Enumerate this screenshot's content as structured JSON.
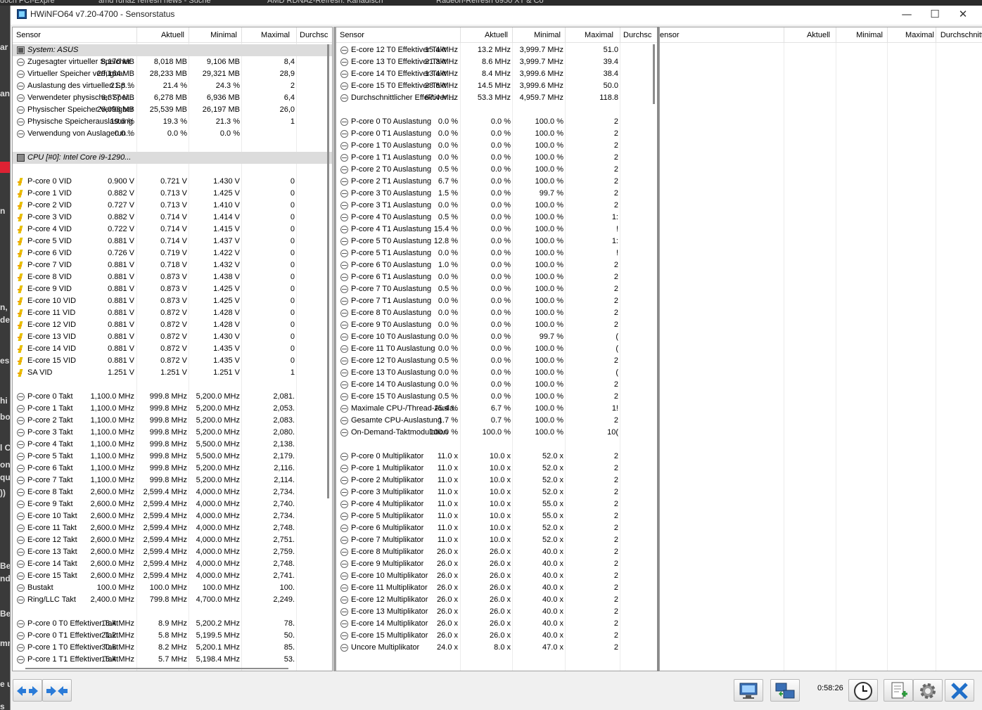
{
  "window": {
    "title": "HWiNFO64 v7.20-4700 - Sensorstatus",
    "minimize": "—",
    "maximize": "☐",
    "close": "✕"
  },
  "background_tabs": [
    "doch PCI-Expre",
    "amd rdna2 refresh news - Suche",
    "AMD RDNA2-Refresh: Kanadisch",
    "Radeon-Refresh 6950 XT & Co"
  ],
  "background_left_text": [
    "ar",
    "an",
    "n",
    "n,",
    "de",
    "es",
    "hi",
    "bo",
    "l C",
    "on",
    "qu",
    "))",
    "Be",
    "nd",
    "Be",
    "mr",
    "e u",
    "s"
  ],
  "columns": {
    "sensor": "Sensor",
    "current": "Aktuell",
    "min": "Minimal",
    "max": "Maximal",
    "avg": "Durchschnitt"
  },
  "panel1": [
    {
      "t": "sec",
      "icon": "comp",
      "name": "System: ASUS"
    },
    {
      "icon": "clock",
      "name": "Zugesagter virtueller Speicher",
      "cur": "8,176 MB",
      "min": "8,018 MB",
      "max": "9,106 MB",
      "avg": "8,4"
    },
    {
      "icon": "clock",
      "name": "Virtueller Speicher verfügbar",
      "cur": "29,164 MB",
      "min": "28,233 MB",
      "max": "29,321 MB",
      "avg": "28,9"
    },
    {
      "icon": "clock",
      "name": "Auslastung des virtuellen Sp...",
      "cur": "21.8 %",
      "min": "21.4 %",
      "max": "24.3 %",
      "avg": "2"
    },
    {
      "icon": "clock",
      "name": "Verwendeter physischer Spei...",
      "cur": "6,377 MB",
      "min": "6,278 MB",
      "max": "6,936 MB",
      "avg": "6,4"
    },
    {
      "icon": "clock",
      "name": "Physischer Speicher Verfügbar",
      "cur": "26,098 MB",
      "min": "25,539 MB",
      "max": "26,197 MB",
      "avg": "26,0"
    },
    {
      "icon": "clock",
      "name": "Physische Speicherauslastung",
      "cur": "19.6 %",
      "min": "19.3 %",
      "max": "21.3 %",
      "avg": "1"
    },
    {
      "icon": "clock",
      "name": "Verwendung von Auslagerun...",
      "cur": "0.0 %",
      "min": "0.0 %",
      "max": "0.0 %",
      "avg": ""
    },
    {
      "t": "blank"
    },
    {
      "t": "sec",
      "icon": "cpu",
      "name": "CPU [#0]: Intel Core i9-1290..."
    },
    {
      "t": "blank"
    },
    {
      "icon": "volt",
      "name": "P-core 0 VID",
      "cur": "0.900 V",
      "min": "0.721 V",
      "max": "1.430 V",
      "avg": "0"
    },
    {
      "icon": "volt",
      "name": "P-core 1 VID",
      "cur": "0.882 V",
      "min": "0.713 V",
      "max": "1.425 V",
      "avg": "0"
    },
    {
      "icon": "volt",
      "name": "P-core 2 VID",
      "cur": "0.727 V",
      "min": "0.713 V",
      "max": "1.410 V",
      "avg": "0"
    },
    {
      "icon": "volt",
      "name": "P-core 3 VID",
      "cur": "0.882 V",
      "min": "0.714 V",
      "max": "1.414 V",
      "avg": "0"
    },
    {
      "icon": "volt",
      "name": "P-core 4 VID",
      "cur": "0.722 V",
      "min": "0.714 V",
      "max": "1.415 V",
      "avg": "0"
    },
    {
      "icon": "volt",
      "name": "P-core 5 VID",
      "cur": "0.881 V",
      "min": "0.714 V",
      "max": "1.437 V",
      "avg": "0"
    },
    {
      "icon": "volt",
      "name": "P-core 6 VID",
      "cur": "0.726 V",
      "min": "0.719 V",
      "max": "1.422 V",
      "avg": "0"
    },
    {
      "icon": "volt",
      "name": "P-core 7 VID",
      "cur": "0.881 V",
      "min": "0.718 V",
      "max": "1.432 V",
      "avg": "0"
    },
    {
      "icon": "volt",
      "name": "E-core 8 VID",
      "cur": "0.881 V",
      "min": "0.873 V",
      "max": "1.438 V",
      "avg": "0"
    },
    {
      "icon": "volt",
      "name": "E-core 9 VID",
      "cur": "0.881 V",
      "min": "0.873 V",
      "max": "1.425 V",
      "avg": "0"
    },
    {
      "icon": "volt",
      "name": "E-core 10 VID",
      "cur": "0.881 V",
      "min": "0.873 V",
      "max": "1.425 V",
      "avg": "0"
    },
    {
      "icon": "volt",
      "name": "E-core 11 VID",
      "cur": "0.881 V",
      "min": "0.872 V",
      "max": "1.428 V",
      "avg": "0"
    },
    {
      "icon": "volt",
      "name": "E-core 12 VID",
      "cur": "0.881 V",
      "min": "0.872 V",
      "max": "1.428 V",
      "avg": "0"
    },
    {
      "icon": "volt",
      "name": "E-core 13 VID",
      "cur": "0.881 V",
      "min": "0.872 V",
      "max": "1.430 V",
      "avg": "0"
    },
    {
      "icon": "volt",
      "name": "E-core 14 VID",
      "cur": "0.881 V",
      "min": "0.872 V",
      "max": "1.435 V",
      "avg": "0"
    },
    {
      "icon": "volt",
      "name": "E-core 15 VID",
      "cur": "0.881 V",
      "min": "0.872 V",
      "max": "1.435 V",
      "avg": "0"
    },
    {
      "icon": "volt",
      "name": "SA VID",
      "cur": "1.251 V",
      "min": "1.251 V",
      "max": "1.251 V",
      "avg": "1"
    },
    {
      "t": "blank"
    },
    {
      "icon": "clock",
      "name": "P-core 0 Takt",
      "cur": "1,100.0 MHz",
      "min": "999.8 MHz",
      "max": "5,200.0 MHz",
      "avg": "2,081."
    },
    {
      "icon": "clock",
      "name": "P-core 1 Takt",
      "cur": "1,100.0 MHz",
      "min": "999.8 MHz",
      "max": "5,200.0 MHz",
      "avg": "2,053."
    },
    {
      "icon": "clock",
      "name": "P-core 2 Takt",
      "cur": "1,100.0 MHz",
      "min": "999.8 MHz",
      "max": "5,200.0 MHz",
      "avg": "2,083."
    },
    {
      "icon": "clock",
      "name": "P-core 3 Takt",
      "cur": "1,100.0 MHz",
      "min": "999.8 MHz",
      "max": "5,200.0 MHz",
      "avg": "2,080."
    },
    {
      "icon": "clock",
      "name": "P-core 4 Takt",
      "cur": "1,100.0 MHz",
      "min": "999.8 MHz",
      "max": "5,500.0 MHz",
      "avg": "2,138."
    },
    {
      "icon": "clock",
      "name": "P-core 5 Takt",
      "cur": "1,100.0 MHz",
      "min": "999.8 MHz",
      "max": "5,500.0 MHz",
      "avg": "2,179."
    },
    {
      "icon": "clock",
      "name": "P-core 6 Takt",
      "cur": "1,100.0 MHz",
      "min": "999.8 MHz",
      "max": "5,200.0 MHz",
      "avg": "2,116."
    },
    {
      "icon": "clock",
      "name": "P-core 7 Takt",
      "cur": "1,100.0 MHz",
      "min": "999.8 MHz",
      "max": "5,200.0 MHz",
      "avg": "2,114."
    },
    {
      "icon": "clock",
      "name": "E-core 8 Takt",
      "cur": "2,600.0 MHz",
      "min": "2,599.4 MHz",
      "max": "4,000.0 MHz",
      "avg": "2,734."
    },
    {
      "icon": "clock",
      "name": "E-core 9 Takt",
      "cur": "2,600.0 MHz",
      "min": "2,599.4 MHz",
      "max": "4,000.0 MHz",
      "avg": "2,740."
    },
    {
      "icon": "clock",
      "name": "E-core 10 Takt",
      "cur": "2,600.0 MHz",
      "min": "2,599.4 MHz",
      "max": "4,000.0 MHz",
      "avg": "2,734."
    },
    {
      "icon": "clock",
      "name": "E-core 11 Takt",
      "cur": "2,600.0 MHz",
      "min": "2,599.4 MHz",
      "max": "4,000.0 MHz",
      "avg": "2,748."
    },
    {
      "icon": "clock",
      "name": "E-core 12 Takt",
      "cur": "2,600.0 MHz",
      "min": "2,599.4 MHz",
      "max": "4,000.0 MHz",
      "avg": "2,751."
    },
    {
      "icon": "clock",
      "name": "E-core 13 Takt",
      "cur": "2,600.0 MHz",
      "min": "2,599.4 MHz",
      "max": "4,000.0 MHz",
      "avg": "2,759."
    },
    {
      "icon": "clock",
      "name": "E-core 14 Takt",
      "cur": "2,600.0 MHz",
      "min": "2,599.4 MHz",
      "max": "4,000.0 MHz",
      "avg": "2,748."
    },
    {
      "icon": "clock",
      "name": "E-core 15 Takt",
      "cur": "2,600.0 MHz",
      "min": "2,599.4 MHz",
      "max": "4,000.0 MHz",
      "avg": "2,741."
    },
    {
      "icon": "clock",
      "name": "Bustakt",
      "cur": "100.0 MHz",
      "min": "100.0 MHz",
      "max": "100.0 MHz",
      "avg": "100."
    },
    {
      "icon": "clock",
      "name": "Ring/LLC Takt",
      "cur": "2,400.0 MHz",
      "min": "799.8 MHz",
      "max": "4,700.0 MHz",
      "avg": "2,249."
    },
    {
      "t": "blank"
    },
    {
      "icon": "clock",
      "name": "P-core 0 T0 Effektiver Takt",
      "cur": "18.4 MHz",
      "min": "8.9 MHz",
      "max": "5,200.2 MHz",
      "avg": "78."
    },
    {
      "icon": "clock",
      "name": "P-core 0 T1 Effektiver Takt",
      "cur": "21.2 MHz",
      "min": "5.8 MHz",
      "max": "5,199.5 MHz",
      "avg": "50."
    },
    {
      "icon": "clock",
      "name": "P-core 1 T0 Effektiver Takt",
      "cur": "30.6 MHz",
      "min": "8.2 MHz",
      "max": "5,200.1 MHz",
      "avg": "85."
    },
    {
      "icon": "clock",
      "name": "P-core 1 T1 Effektiver Takt",
      "cur": "15.4 MHz",
      "min": "5.7 MHz",
      "max": "5,198.4 MHz",
      "avg": "53."
    }
  ],
  "panel2": [
    {
      "icon": "clock",
      "name": "E-core 12 T0 Effektiver Takt",
      "cur": "15.4 MHz",
      "min": "13.2 MHz",
      "max": "3,999.7 MHz",
      "avg": "51.0"
    },
    {
      "icon": "clock",
      "name": "E-core 13 T0 Effektiver Takt",
      "cur": "21.3 MHz",
      "min": "8.6 MHz",
      "max": "3,999.7 MHz",
      "avg": "39.4"
    },
    {
      "icon": "clock",
      "name": "E-core 14 T0 Effektiver Takt",
      "cur": "13.4 MHz",
      "min": "8.4 MHz",
      "max": "3,999.6 MHz",
      "avg": "38.4"
    },
    {
      "icon": "clock",
      "name": "E-core 15 T0 Effektiver Takt",
      "cur": "28.6 MHz",
      "min": "14.5 MHz",
      "max": "3,999.6 MHz",
      "avg": "50.0"
    },
    {
      "icon": "clock",
      "name": "Durchschnittlicher Effektiver ...",
      "cur": "67.4 MHz",
      "min": "53.3 MHz",
      "max": "4,959.7 MHz",
      "avg": "118.8"
    },
    {
      "t": "blank"
    },
    {
      "icon": "clock",
      "name": "P-core 0 T0 Auslastung",
      "cur": "0.0 %",
      "min": "0.0 %",
      "max": "100.0 %",
      "avg": "2"
    },
    {
      "icon": "clock",
      "name": "P-core 0 T1 Auslastung",
      "cur": "0.0 %",
      "min": "0.0 %",
      "max": "100.0 %",
      "avg": "2"
    },
    {
      "icon": "clock",
      "name": "P-core 1 T0 Auslastung",
      "cur": "0.0 %",
      "min": "0.0 %",
      "max": "100.0 %",
      "avg": "2"
    },
    {
      "icon": "clock",
      "name": "P-core 1 T1 Auslastung",
      "cur": "0.0 %",
      "min": "0.0 %",
      "max": "100.0 %",
      "avg": "2"
    },
    {
      "icon": "clock",
      "name": "P-core 2 T0 Auslastung",
      "cur": "0.5 %",
      "min": "0.0 %",
      "max": "100.0 %",
      "avg": "2"
    },
    {
      "icon": "clock",
      "name": "P-core 2 T1 Auslastung",
      "cur": "6.7 %",
      "min": "0.0 %",
      "max": "100.0 %",
      "avg": "2"
    },
    {
      "icon": "clock",
      "name": "P-core 3 T0 Auslastung",
      "cur": "1.5 %",
      "min": "0.0 %",
      "max": "99.7 %",
      "avg": "2"
    },
    {
      "icon": "clock",
      "name": "P-core 3 T1 Auslastung",
      "cur": "0.0 %",
      "min": "0.0 %",
      "max": "100.0 %",
      "avg": "2"
    },
    {
      "icon": "clock",
      "name": "P-core 4 T0 Auslastung",
      "cur": "0.5 %",
      "min": "0.0 %",
      "max": "100.0 %",
      "avg": "1:"
    },
    {
      "icon": "clock",
      "name": "P-core 4 T1 Auslastung",
      "cur": "15.4 %",
      "min": "0.0 %",
      "max": "100.0 %",
      "avg": "!"
    },
    {
      "icon": "clock",
      "name": "P-core 5 T0 Auslastung",
      "cur": "12.8 %",
      "min": "0.0 %",
      "max": "100.0 %",
      "avg": "1:"
    },
    {
      "icon": "clock",
      "name": "P-core 5 T1 Auslastung",
      "cur": "0.0 %",
      "min": "0.0 %",
      "max": "100.0 %",
      "avg": "!"
    },
    {
      "icon": "clock",
      "name": "P-core 6 T0 Auslastung",
      "cur": "1.0 %",
      "min": "0.0 %",
      "max": "100.0 %",
      "avg": "2"
    },
    {
      "icon": "clock",
      "name": "P-core 6 T1 Auslastung",
      "cur": "0.0 %",
      "min": "0.0 %",
      "max": "100.0 %",
      "avg": "2"
    },
    {
      "icon": "clock",
      "name": "P-core 7 T0 Auslastung",
      "cur": "0.5 %",
      "min": "0.0 %",
      "max": "100.0 %",
      "avg": "2"
    },
    {
      "icon": "clock",
      "name": "P-core 7 T1 Auslastung",
      "cur": "0.0 %",
      "min": "0.0 %",
      "max": "100.0 %",
      "avg": "2"
    },
    {
      "icon": "clock",
      "name": "E-core 8 T0 Auslastung",
      "cur": "0.0 %",
      "min": "0.0 %",
      "max": "100.0 %",
      "avg": "2"
    },
    {
      "icon": "clock",
      "name": "E-core 9 T0 Auslastung",
      "cur": "0.0 %",
      "min": "0.0 %",
      "max": "100.0 %",
      "avg": "2"
    },
    {
      "icon": "clock",
      "name": "E-core 10 T0 Auslastung",
      "cur": "0.0 %",
      "min": "0.0 %",
      "max": "99.7 %",
      "avg": "("
    },
    {
      "icon": "clock",
      "name": "E-core 11 T0 Auslastung",
      "cur": "0.0 %",
      "min": "0.0 %",
      "max": "100.0 %",
      "avg": "("
    },
    {
      "icon": "clock",
      "name": "E-core 12 T0 Auslastung",
      "cur": "0.5 %",
      "min": "0.0 %",
      "max": "100.0 %",
      "avg": "2"
    },
    {
      "icon": "clock",
      "name": "E-core 13 T0 Auslastung",
      "cur": "0.0 %",
      "min": "0.0 %",
      "max": "100.0 %",
      "avg": "("
    },
    {
      "icon": "clock",
      "name": "E-core 14 T0 Auslastung",
      "cur": "0.0 %",
      "min": "0.0 %",
      "max": "100.0 %",
      "avg": "2"
    },
    {
      "icon": "clock",
      "name": "E-core 15 T0 Auslastung",
      "cur": "0.5 %",
      "min": "0.0 %",
      "max": "100.0 %",
      "avg": "2"
    },
    {
      "icon": "clock",
      "name": "Maximale CPU-/Thread-Ausla...",
      "cur": "15.4 %",
      "min": "6.7 %",
      "max": "100.0 %",
      "avg": "1!"
    },
    {
      "icon": "clock",
      "name": "Gesamte CPU-Auslastung",
      "cur": "1.7 %",
      "min": "0.7 %",
      "max": "100.0 %",
      "avg": "2"
    },
    {
      "icon": "clock",
      "name": "On-Demand-Taktmodulation",
      "cur": "100.0 %",
      "min": "100.0 %",
      "max": "100.0 %",
      "avg": "10("
    },
    {
      "t": "blank"
    },
    {
      "icon": "clock",
      "name": "P-core 0 Multiplikator",
      "cur": "11.0 x",
      "min": "10.0 x",
      "max": "52.0 x",
      "avg": "2"
    },
    {
      "icon": "clock",
      "name": "P-core 1 Multiplikator",
      "cur": "11.0 x",
      "min": "10.0 x",
      "max": "52.0 x",
      "avg": "2"
    },
    {
      "icon": "clock",
      "name": "P-core 2 Multiplikator",
      "cur": "11.0 x",
      "min": "10.0 x",
      "max": "52.0 x",
      "avg": "2"
    },
    {
      "icon": "clock",
      "name": "P-core 3 Multiplikator",
      "cur": "11.0 x",
      "min": "10.0 x",
      "max": "52.0 x",
      "avg": "2"
    },
    {
      "icon": "clock",
      "name": "P-core 4 Multiplikator",
      "cur": "11.0 x",
      "min": "10.0 x",
      "max": "55.0 x",
      "avg": "2"
    },
    {
      "icon": "clock",
      "name": "P-core 5 Multiplikator",
      "cur": "11.0 x",
      "min": "10.0 x",
      "max": "55.0 x",
      "avg": "2"
    },
    {
      "icon": "clock",
      "name": "P-core 6 Multiplikator",
      "cur": "11.0 x",
      "min": "10.0 x",
      "max": "52.0 x",
      "avg": "2"
    },
    {
      "icon": "clock",
      "name": "P-core 7 Multiplikator",
      "cur": "11.0 x",
      "min": "10.0 x",
      "max": "52.0 x",
      "avg": "2"
    },
    {
      "icon": "clock",
      "name": "E-core 8 Multiplikator",
      "cur": "26.0 x",
      "min": "26.0 x",
      "max": "40.0 x",
      "avg": "2"
    },
    {
      "icon": "clock",
      "name": "E-core 9 Multiplikator",
      "cur": "26.0 x",
      "min": "26.0 x",
      "max": "40.0 x",
      "avg": "2"
    },
    {
      "icon": "clock",
      "name": "E-core 10 Multiplikator",
      "cur": "26.0 x",
      "min": "26.0 x",
      "max": "40.0 x",
      "avg": "2"
    },
    {
      "icon": "clock",
      "name": "E-core 11 Multiplikator",
      "cur": "26.0 x",
      "min": "26.0 x",
      "max": "40.0 x",
      "avg": "2"
    },
    {
      "icon": "clock",
      "name": "E-core 12 Multiplikator",
      "cur": "26.0 x",
      "min": "26.0 x",
      "max": "40.0 x",
      "avg": "2"
    },
    {
      "icon": "clock",
      "name": "E-core 13 Multiplikator",
      "cur": "26.0 x",
      "min": "26.0 x",
      "max": "40.0 x",
      "avg": "2"
    },
    {
      "icon": "clock",
      "name": "E-core 14 Multiplikator",
      "cur": "26.0 x",
      "min": "26.0 x",
      "max": "40.0 x",
      "avg": "2"
    },
    {
      "icon": "clock",
      "name": "E-core 15 Multiplikator",
      "cur": "26.0 x",
      "min": "26.0 x",
      "max": "40.0 x",
      "avg": "2"
    },
    {
      "icon": "clock",
      "name": "Uncore Multiplikator",
      "cur": "24.0 x",
      "min": "8.0 x",
      "max": "47.0 x",
      "avg": "2"
    }
  ],
  "panel3_header": {
    "sensor": "ensor",
    "current": "Aktuell",
    "min": "Minimal",
    "max": "Maximal",
    "avg": "Durchschnitt"
  },
  "toolbar": {
    "expand_icon": "arrows-expand-icon",
    "collapse_icon": "arrows-collapse-icon",
    "network_icon": "network-monitor-icon",
    "switch_icon": "switch-layout-icon",
    "timer": "0:58:26",
    "clock_icon": "clock-icon",
    "add_report_icon": "add-report-icon",
    "settings_icon": "gear-icon",
    "close_icon": "close-icon"
  }
}
